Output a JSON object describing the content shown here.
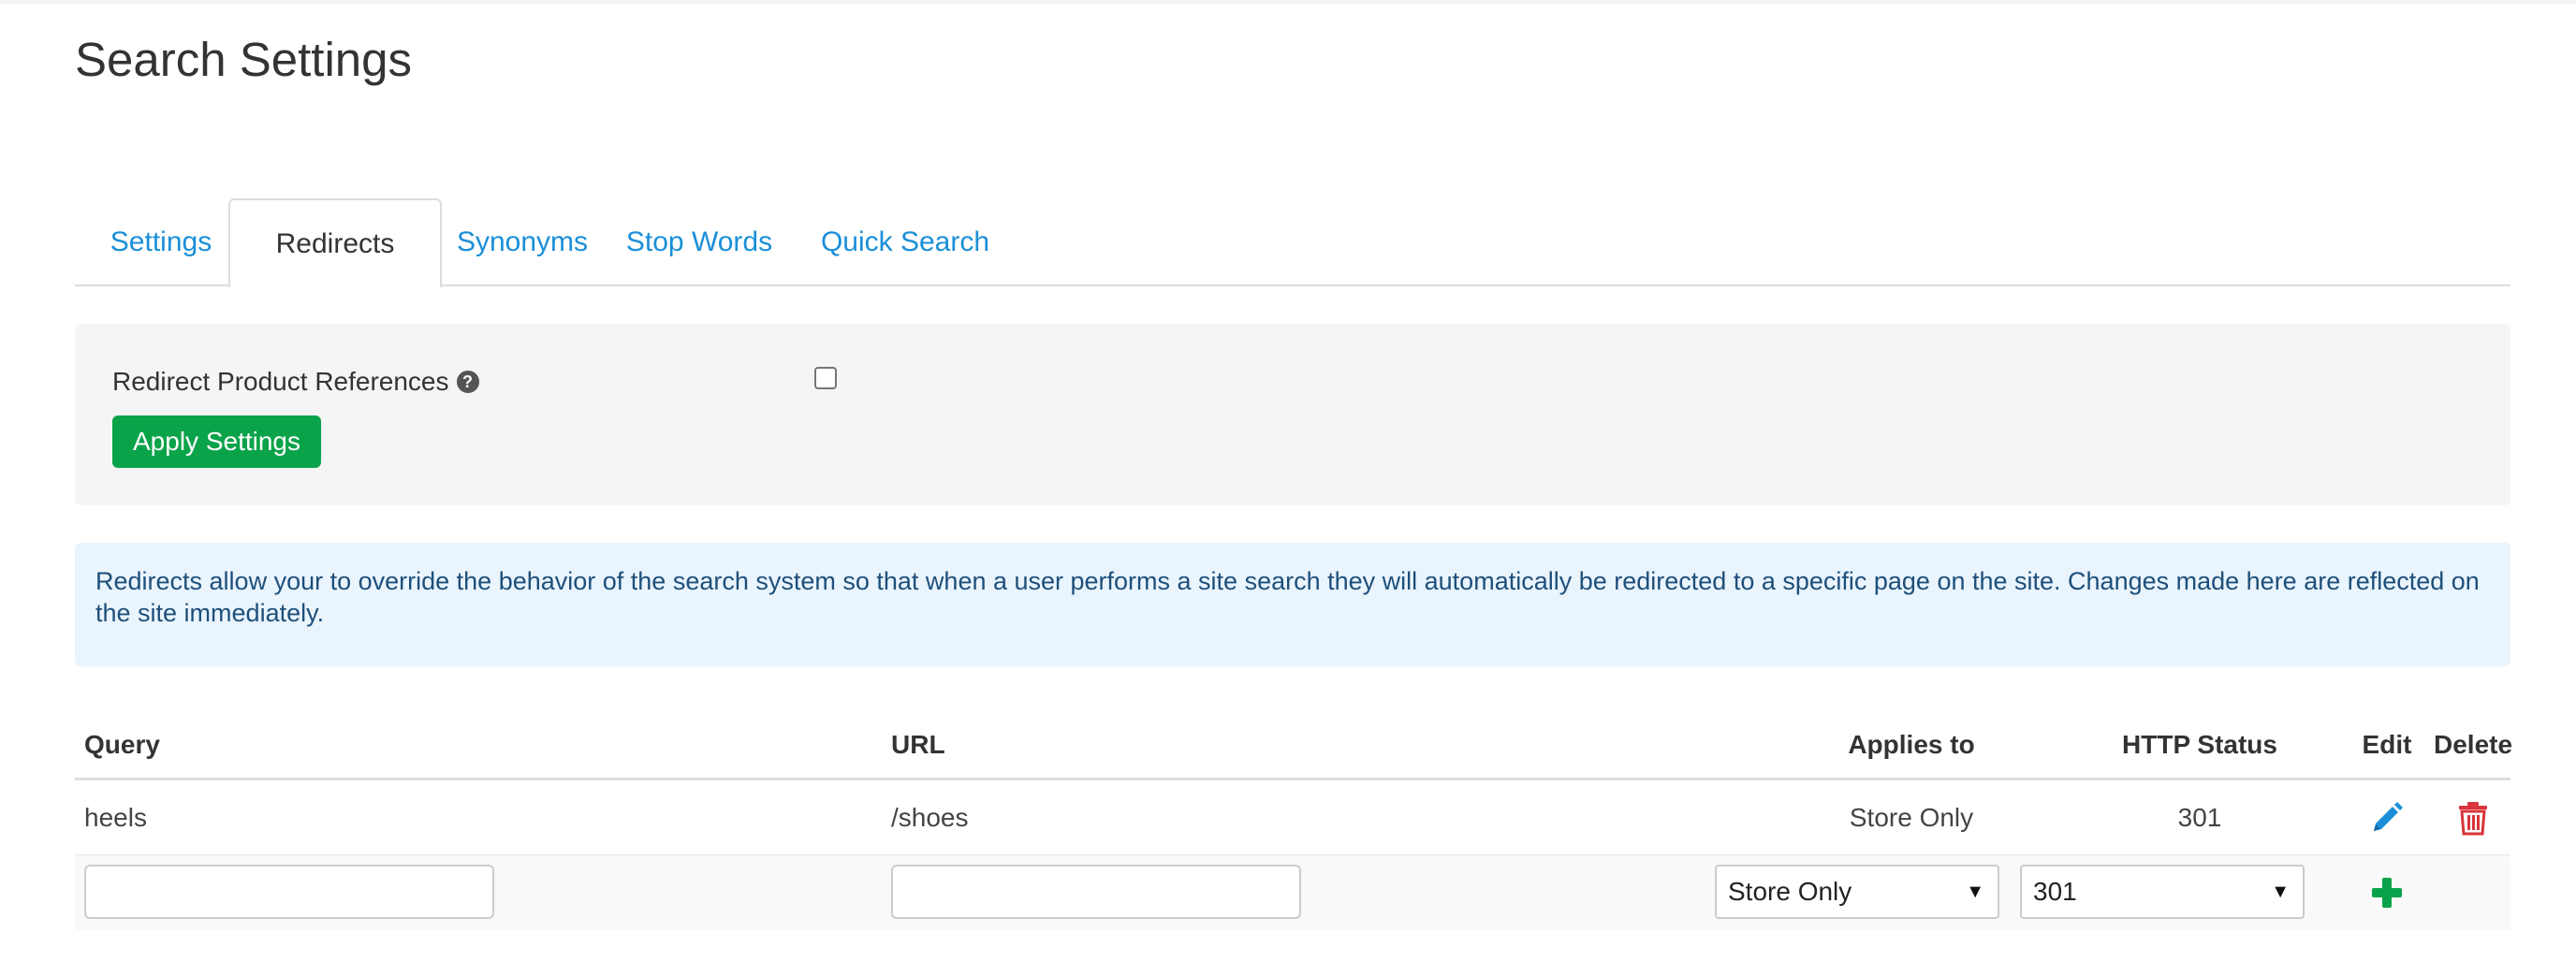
{
  "page": {
    "title": "Search Settings"
  },
  "tabs": [
    {
      "label": "Settings",
      "active": false
    },
    {
      "label": "Redirects",
      "active": true
    },
    {
      "label": "Synonyms",
      "active": false
    },
    {
      "label": "Stop Words",
      "active": false
    },
    {
      "label": "Quick Search",
      "active": false
    }
  ],
  "settings_panel": {
    "redirect_label": "Redirect Product References",
    "help_icon": "?",
    "checkbox_checked": false,
    "apply_button": "Apply Settings"
  },
  "info_alert": {
    "text": "Redirects allow your to override the behavior of the search system so that when a user performs a site search they will automatically be redirected to a specific page on the site. Changes made here are reflected on the site immediately."
  },
  "table": {
    "headers": {
      "query": "Query",
      "url": "URL",
      "applies_to": "Applies to",
      "http_status": "HTTP Status",
      "edit": "Edit",
      "delete": "Delete"
    },
    "rows": [
      {
        "query": "heels",
        "url": "/shoes",
        "applies_to": "Store Only",
        "http_status": "301",
        "edit_icon": "pencil-icon",
        "delete_icon": "trash-icon"
      }
    ],
    "new_row": {
      "query_value": "",
      "url_value": "",
      "applies_to_selected": "Store Only",
      "http_status_selected": "301",
      "add_icon": "plus-icon"
    }
  },
  "colors": {
    "link": "#1a8fd8",
    "apply_button": "#0ba34a",
    "alert_bg": "#e9f4fd",
    "alert_text": "#1e4f7a",
    "edit_icon": "#1a8fd8",
    "delete_icon": "#d9343b",
    "add_icon": "#0ba34a"
  }
}
